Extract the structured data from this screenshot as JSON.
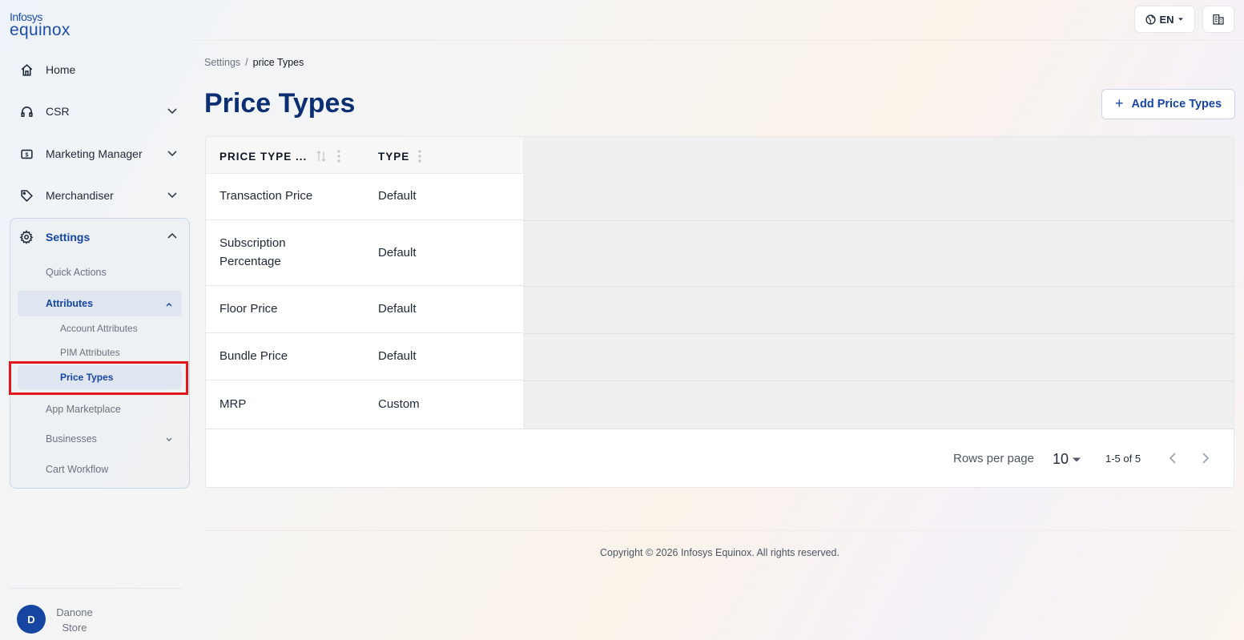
{
  "logo": {
    "line1": "Infosys",
    "line2": "equinox"
  },
  "sidebar": {
    "items": [
      {
        "label": "Home",
        "icon": "home-icon"
      },
      {
        "label": "CSR",
        "icon": "headset-icon"
      },
      {
        "label": "Marketing Manager",
        "icon": "dollar-badge-icon"
      },
      {
        "label": "Merchandiser",
        "icon": "tag-icon"
      },
      {
        "label": "Settings",
        "icon": "gear-icon"
      }
    ],
    "settings_sub": {
      "quick_actions": "Quick Actions",
      "attributes": "Attributes",
      "account_attributes": "Account Attributes",
      "pim_attributes": "PIM Attributes",
      "price_types": "Price Types",
      "app_marketplace": "App Marketplace",
      "businesses": "Businesses",
      "cart_workflow": "Cart Workflow"
    },
    "user": {
      "initial": "D",
      "name_line1": "Danone",
      "name_line2": "Store"
    }
  },
  "topbar": {
    "language": "EN"
  },
  "breadcrumb": {
    "parent": "Settings",
    "separator": "/",
    "current": "price Types"
  },
  "page": {
    "title": "Price Types",
    "add_button": "Add Price Types",
    "add_plus": "+"
  },
  "table": {
    "headers": {
      "price_type": "PRICE TYPE ...",
      "type": "TYPE"
    },
    "rows": [
      {
        "name": "Transaction Price",
        "type": "Default"
      },
      {
        "name_l1": "Subscription",
        "name_l2": "Percentage",
        "type": "Default"
      },
      {
        "name": "Floor Price",
        "type": "Default"
      },
      {
        "name": "Bundle Price",
        "type": "Default"
      },
      {
        "name": "MRP",
        "type": "Custom"
      }
    ],
    "pagination": {
      "rows_per_page_label": "Rows per page",
      "rows_per_page": "10",
      "range": "1-5 of 5"
    }
  },
  "footer": {
    "copyright": "Copyright © 2026 Infosys Equinox. All rights reserved."
  },
  "colors": {
    "brand": "#1746a2",
    "title": "#0c2f73",
    "highlight": "#e3161b"
  }
}
